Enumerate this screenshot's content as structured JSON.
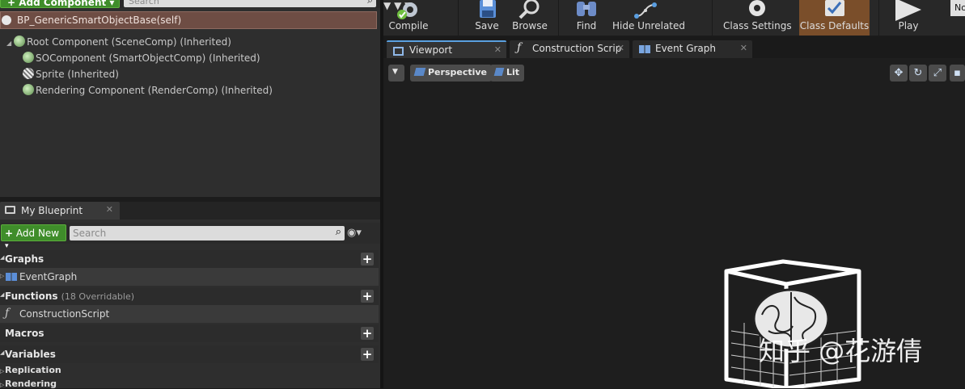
{
  "components": {
    "add_label": "+ Add Component ▾",
    "search_placeholder": "Search",
    "root_title": "BP_GenericSmartObjectBase(self)",
    "tree": [
      "Root Component (SceneComp) (Inherited)",
      "SOComponent (SmartObjectComp) (Inherited)",
      "Sprite (Inherited)",
      "Rendering Component (RenderComp) (Inherited)"
    ]
  },
  "my_blueprint": {
    "tab_label": "My Blueprint",
    "add_new_label": "Add New",
    "search_placeholder": "Search",
    "sections": {
      "graphs": "Graphs",
      "functions": "Functions",
      "functions_note": "(18 Overridable)",
      "macros": "Macros",
      "variables": "Variables"
    },
    "items": {
      "event_graph": "EventGraph",
      "construction_script": "ConstructionScript"
    },
    "categories": [
      "Replication",
      "Rendering"
    ]
  },
  "toolbar": {
    "compile": "Compile",
    "save": "Save",
    "browse": "Browse",
    "find": "Find",
    "hide_unrelated": "Hide Unrelated",
    "class_settings": "Class Settings",
    "class_defaults": "Class Defaults",
    "play": "Play",
    "debug_filter": "No"
  },
  "tabs": [
    "Viewport",
    "Construction Scrip",
    "Event Graph"
  ],
  "viewport": {
    "perspective": "Perspective",
    "lit": "Lit"
  },
  "watermark": "知乎 @花游倩",
  "colors": {
    "green_button": "#3f8d2a",
    "self_row": "#6e4d44",
    "class_defaults_active": "#7a4e2a",
    "tab_accent": "#5aa0e0"
  }
}
